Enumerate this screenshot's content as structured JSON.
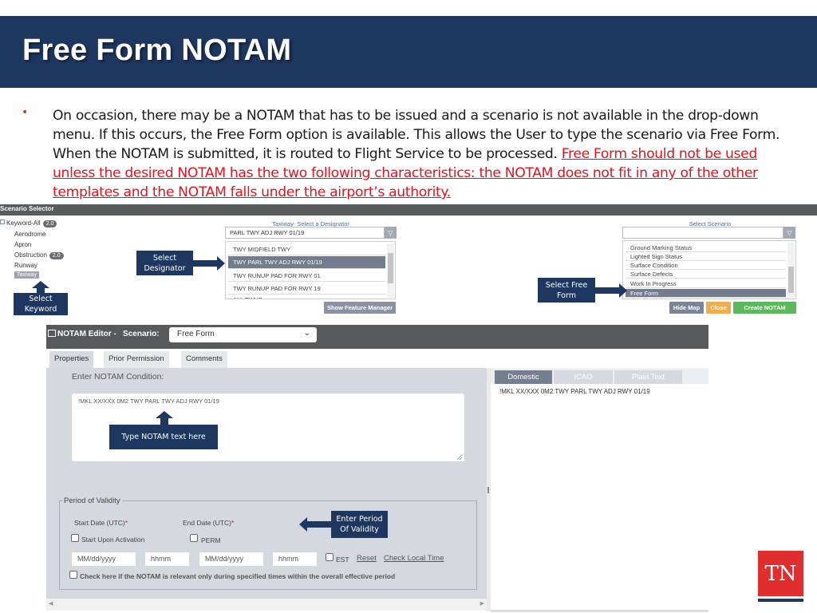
{
  "slide": {
    "title": "Free Form NOTAM",
    "bullet": "•",
    "body_plain": "On occasion, there may be a NOTAM that has to be issued and a scenario is not available in the drop-down menu. If this occurs, the Free Form option is available. This allows the User to type the scenario via Free Form. When the NOTAM is submitted, it is routed to Flight Service to be processed.",
    "body_warning": "Free Form should not be used unless the desired NOTAM has the two following characteristics: the NOTAM does not fit in any of the other templates and the NOTAM falls under the airport’s authority.",
    "logo_text": "TN"
  },
  "scenario_selector": {
    "title": "Scenario Selector",
    "tree": [
      {
        "label": "Keyword-All",
        "badge": "2.0"
      },
      {
        "label": "Aerodrome"
      },
      {
        "label": "Apron"
      },
      {
        "label": "Obstruction",
        "badge": "2.0"
      },
      {
        "label": "Runway"
      },
      {
        "label": "Taxiway",
        "selected": true
      }
    ]
  },
  "designator": {
    "title": "Taxiway- Select a Designator",
    "filter_value": "PARL TWY ADJ RWY 01/19",
    "items": [
      {
        "label": "TWY MIDFIELD TWY"
      },
      {
        "label": "TWY PARL TWY ADJ RWY 01/19",
        "selected": true
      },
      {
        "label": "TWY RUNUP PAD FOR RWY 01"
      },
      {
        "label": "TWY RUNUP PAD FOR RWY 19"
      },
      {
        "label": "ALL TWYS"
      }
    ],
    "show_feature_manager": "Show Feature Manager"
  },
  "scenario_list": {
    "title": "Select Scenario",
    "filter_value": "",
    "items": [
      {
        "label": "Ground Marking Status"
      },
      {
        "label": "Lighted Sign Status"
      },
      {
        "label": "Surface Condition"
      },
      {
        "label": "Surface Defects"
      },
      {
        "label": "Work In Progress"
      },
      {
        "label": "Free Form",
        "selected": true
      }
    ],
    "buttons": {
      "hide_map": "Hide Map",
      "close": "Close",
      "create": "Create NOTAM"
    }
  },
  "callouts": {
    "select_keyword": "Select Keyword",
    "select_designator": "Select Designator",
    "select_free_form": "Select Free Form",
    "type_text": "Type NOTAM text here",
    "enter_period": "Enter Period Of Validity"
  },
  "editor": {
    "title": "NOTAM Editor -",
    "scenario_label": "Scenario:",
    "scenario_value": "Free Form",
    "tabs": [
      {
        "label": "Properties",
        "active": true
      },
      {
        "label": "Prior Permission"
      },
      {
        "label": "Comments"
      }
    ],
    "condition_label": "Enter NOTAM Condition:",
    "condition_text": "!MKL XX/XXX 0M2 TWY PARL TWY ADJ RWY 01/19",
    "period": {
      "legend": "Period of Validity",
      "start_label": "Start Date (UTC)",
      "end_label": "End Date (UTC)",
      "required_mark": "*",
      "start_upon_activation": "Start Upon Activation",
      "perm": "PERM",
      "start_date_placeholder": "MM/dd/yyyy",
      "start_time_placeholder": "hhmm",
      "end_date_placeholder": "MM/dd/yyyy",
      "end_time_placeholder": "hhmm",
      "est": "EST",
      "reset": "Reset",
      "check_local_time": "Check Local Time",
      "schedule_check": "Check here if the NOTAM is relevant only during specified times within the overall effective period"
    },
    "preview_tabs": [
      {
        "label": "Domestic",
        "active": true
      },
      {
        "label": "ICAO"
      },
      {
        "label": "Plain Text"
      }
    ],
    "preview_text": "!MKL XX/XXX 0M2 TWY PARL TWY ADJ RWY 01/19"
  },
  "colors": {
    "brand_navy": "#1e3760",
    "warning_red": "#e0141e",
    "create_green": "#5cb85c",
    "close_orange": "#f0ad4e",
    "logo_red": "#e02d2d"
  }
}
